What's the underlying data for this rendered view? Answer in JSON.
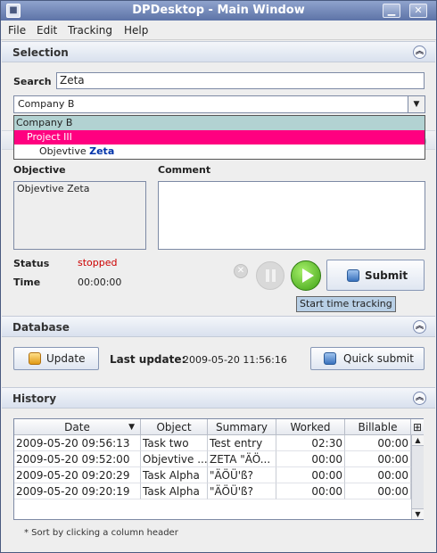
{
  "window": {
    "title": "DPDesktop - Main Window"
  },
  "menu": [
    "File",
    "Edit",
    "Tracking",
    "Help"
  ],
  "selection": {
    "header": "Selection",
    "search_label": "Search",
    "search_value": "Zeta",
    "combo_value": "Company B",
    "dropdown": [
      {
        "text": "Company B"
      },
      {
        "text": "Project III"
      },
      {
        "text_prefix": "Objevtive ",
        "text_highlight": "Zeta"
      }
    ],
    "objective_label": "Objective",
    "objective_value": "Objevtive Zeta",
    "comment_label": "Comment",
    "comment_value": "",
    "status_label": "Status",
    "status_value": "stopped",
    "time_label": "Time",
    "time_value": "00:00:00",
    "submit_label": "Submit",
    "tooltip": "Start time tracking",
    "colors": {
      "status": "#cc0000",
      "selected_row": "#ff0080",
      "highlight_text": "#0033aa"
    }
  },
  "database": {
    "header": "Database",
    "update_label": "Update",
    "last_update_label": "Last update:",
    "last_update_value": "2009-05-20 11:56:16",
    "quick_submit_label": "Quick submit"
  },
  "history": {
    "header": "History",
    "columns": [
      "Date",
      "Object",
      "Summary",
      "Worked",
      "Billable"
    ],
    "rows": [
      [
        "2009-05-20 09:56:13",
        "Task two",
        "Test entry",
        "02:30",
        "00:00"
      ],
      [
        "2009-05-20 09:52:00",
        "Objevtive ...",
        "ZETA \"ÄÖ...",
        "00:00",
        "00:00"
      ],
      [
        "2009-05-20 09:20:29",
        "Task Alpha",
        "\"ÄÖÜ'ß?",
        "00:00",
        "00:00"
      ],
      [
        "2009-05-20 09:20:19",
        "Task Alpha",
        "\"ÄÖÜ'ß?",
        "00:00",
        "00:00"
      ]
    ],
    "footnote": "* Sort by clicking a column header"
  }
}
